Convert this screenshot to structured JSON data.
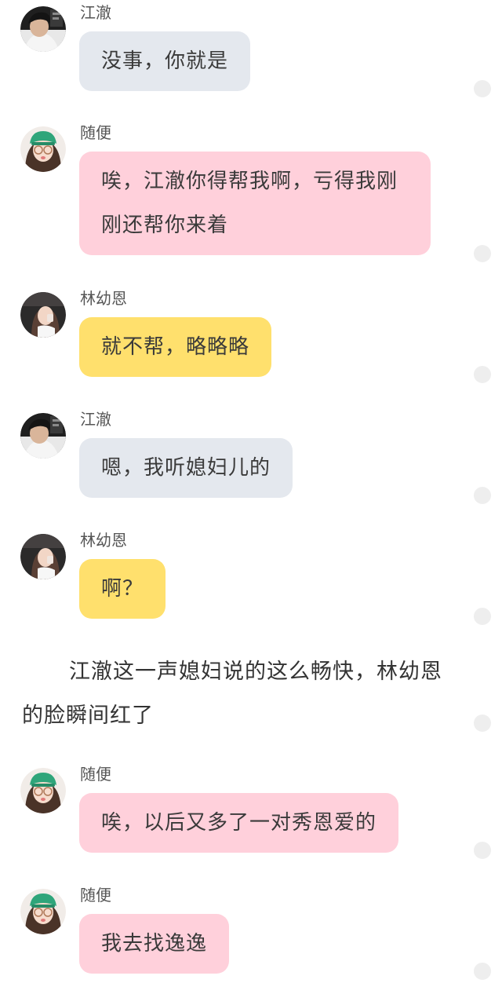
{
  "colors": {
    "bubble_jiangche": "#e4e8ee",
    "bubble_suibian": "#ffd0db",
    "bubble_linyouen": "#ffe06d",
    "read_indicator": "#eeeeee"
  },
  "messages": [
    {
      "sender": "江澈",
      "avatar": "avatar-jiangche-icon",
      "text": "没事，你就是"
    },
    {
      "sender": "随便",
      "avatar": "avatar-suibian-icon",
      "text": "唉，江澈你得帮我啊，亏得我刚刚还帮你来着"
    },
    {
      "sender": "林幼恩",
      "avatar": "avatar-linyouen-icon",
      "text": "就不帮，略略略"
    },
    {
      "sender": "江澈",
      "avatar": "avatar-jiangche-icon",
      "text": "嗯，我听媳妇儿的"
    },
    {
      "sender": "林幼恩",
      "avatar": "avatar-linyouen-icon",
      "text": "啊？"
    },
    {
      "sender": "随便",
      "avatar": "avatar-suibian-icon",
      "text": "唉，以后又多了一对秀恩爱的"
    },
    {
      "sender": "随便",
      "avatar": "avatar-suibian-icon",
      "text": "我去找逸逸"
    }
  ],
  "narration": "江澈这一声媳妇说的这么畅快，林幼恩的脸瞬间红了"
}
